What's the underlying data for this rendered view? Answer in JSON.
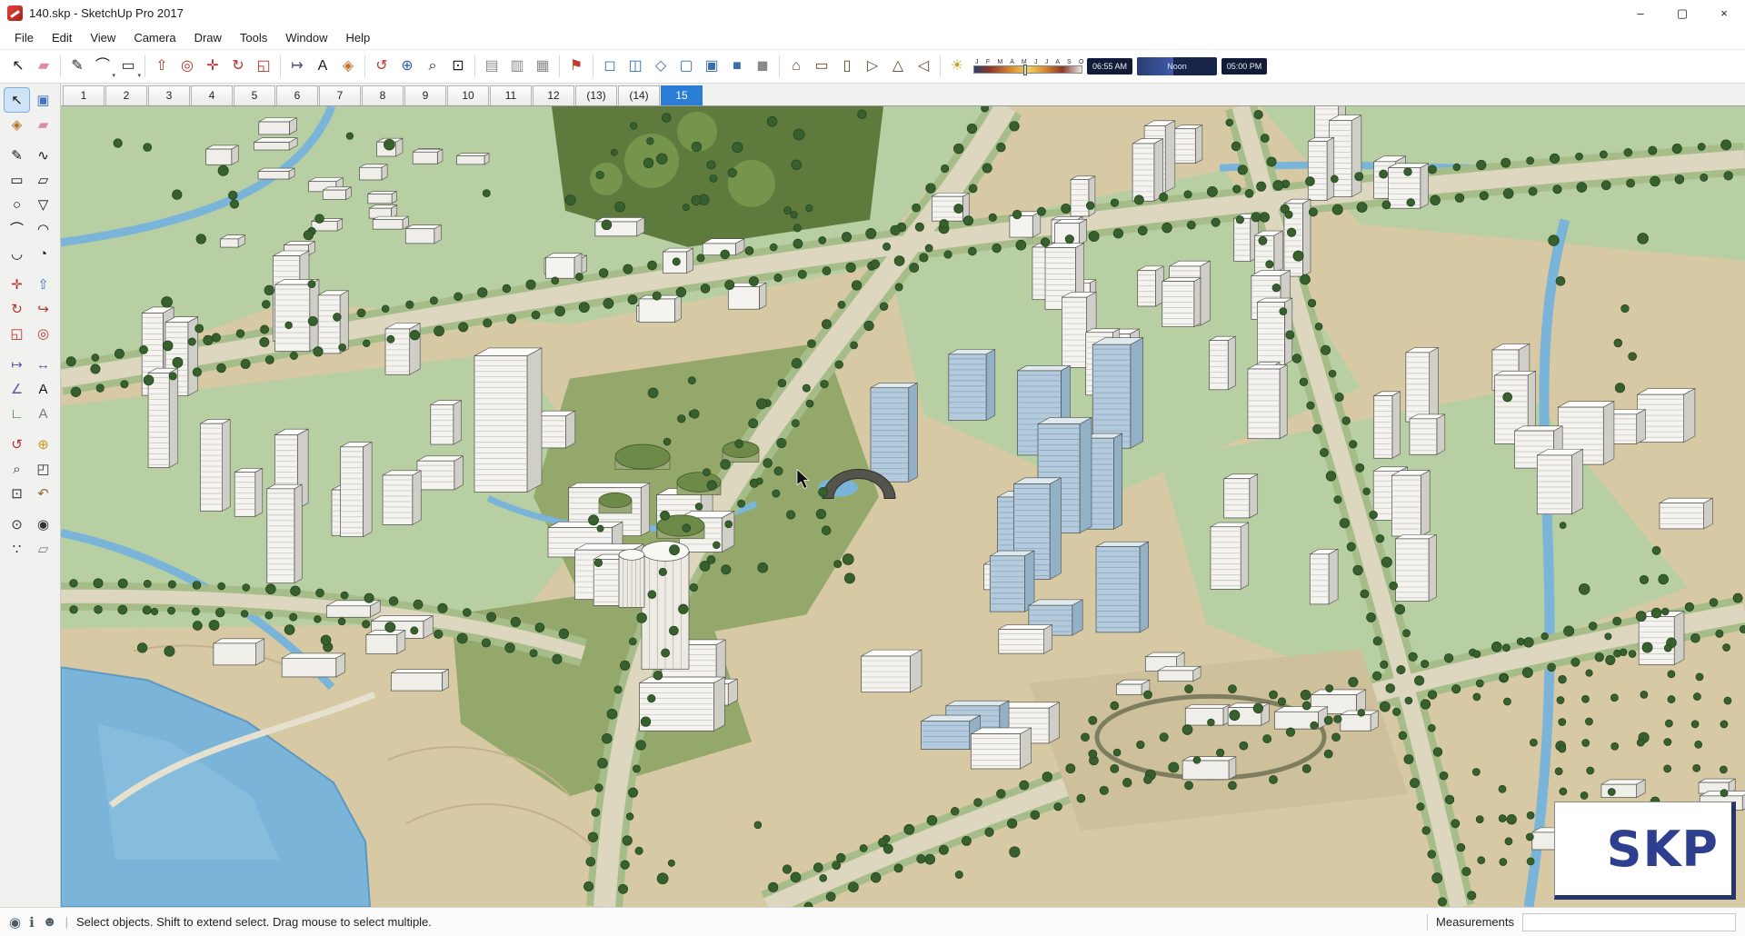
{
  "window": {
    "title": "140.skp - SketchUp Pro 2017",
    "controls": [
      {
        "name": "minimize",
        "glyph": "–"
      },
      {
        "name": "maximize",
        "glyph": "▢"
      },
      {
        "name": "close",
        "glyph": "×"
      }
    ]
  },
  "menu": {
    "items": [
      "File",
      "Edit",
      "View",
      "Camera",
      "Draw",
      "Tools",
      "Window",
      "Help"
    ]
  },
  "toolbar": {
    "tools": [
      {
        "name": "select",
        "glyph": "↖",
        "color": "#1a1a1a"
      },
      {
        "name": "eraser",
        "glyph": "▰",
        "color": "#e08aa8"
      },
      {
        "sep": true
      },
      {
        "name": "line",
        "glyph": "✎",
        "color": "#1a1a1a"
      },
      {
        "name": "arcs",
        "glyph": "⌒",
        "color": "#1a1a1a",
        "dropdown": true
      },
      {
        "name": "shapes",
        "glyph": "▭",
        "color": "#1a1a1a",
        "dropdown": true
      },
      {
        "sep": true
      },
      {
        "name": "push-pull",
        "glyph": "⇧",
        "color": "#b5342a"
      },
      {
        "name": "offset",
        "glyph": "◎",
        "color": "#b5342a"
      },
      {
        "name": "move",
        "glyph": "✛",
        "color": "#b5342a"
      },
      {
        "name": "rotate",
        "glyph": "↻",
        "color": "#b5342a"
      },
      {
        "name": "scale",
        "glyph": "◱",
        "color": "#b5342a"
      },
      {
        "sep": true
      },
      {
        "name": "tape-measure",
        "glyph": "↦",
        "color": "#4a4a8a"
      },
      {
        "name": "text",
        "glyph": "A",
        "color": "#1a1a1a"
      },
      {
        "name": "paint-bucket",
        "glyph": "◈",
        "color": "#c2702a"
      },
      {
        "sep": true
      },
      {
        "name": "orbit",
        "glyph": "↺",
        "color": "#c0392b"
      },
      {
        "name": "pan",
        "glyph": "⊕",
        "color": "#2e5fa3"
      },
      {
        "name": "zoom",
        "glyph": "⌕",
        "color": "#1a1a1a"
      },
      {
        "name": "zoom-extents",
        "glyph": "⊡",
        "color": "#1a1a1a"
      },
      {
        "sep": true
      },
      {
        "name": "section-plane",
        "glyph": "▤",
        "color": "#8a8a8a"
      },
      {
        "name": "section-fill",
        "glyph": "▥",
        "color": "#8a8a8a"
      },
      {
        "name": "section-display",
        "glyph": "▦",
        "color": "#8a8a8a"
      },
      {
        "sep": true
      },
      {
        "name": "add-location",
        "glyph": "⚑",
        "color": "#c0392b"
      },
      {
        "sep": true
      },
      {
        "name": "style-xray",
        "glyph": "◻",
        "color": "#3a6ea8"
      },
      {
        "name": "style-back-edges",
        "glyph": "◫",
        "color": "#3a6ea8"
      },
      {
        "name": "style-wireframe",
        "glyph": "◇",
        "color": "#3a6ea8"
      },
      {
        "name": "style-hidden-line",
        "glyph": "▢",
        "color": "#3a6ea8"
      },
      {
        "name": "style-shaded",
        "glyph": "▣",
        "color": "#3a6ea8"
      },
      {
        "name": "style-shaded-textures",
        "glyph": "■",
        "color": "#3a6ea8"
      },
      {
        "name": "style-monochrome",
        "glyph": "◼",
        "color": "#8a8a8a"
      },
      {
        "sep": true
      },
      {
        "name": "view-iso",
        "glyph": "⌂",
        "color": "#6a4a2a"
      },
      {
        "name": "view-top",
        "glyph": "▭",
        "color": "#6a4a2a"
      },
      {
        "name": "view-front",
        "glyph": "▯",
        "color": "#6a4a2a"
      },
      {
        "name": "view-right",
        "glyph": "▷",
        "color": "#6a4a2a"
      },
      {
        "name": "view-back",
        "glyph": "△",
        "color": "#6a4a2a"
      },
      {
        "name": "view-left",
        "glyph": "◁",
        "color": "#6a4a2a"
      },
      {
        "sep": true
      },
      {
        "name": "shadows-dialog",
        "glyph": "☀",
        "color": "#c8a22a"
      }
    ],
    "shadow": {
      "months": "J F M A M J J A S O N D",
      "time_start": "06:55 AM",
      "noon_label": "Noon",
      "time_end": "05:00 PM"
    }
  },
  "scene_tabs": {
    "tabs": [
      "1",
      "2",
      "3",
      "4",
      "5",
      "6",
      "7",
      "8",
      "9",
      "10",
      "11",
      "12",
      "(13)",
      "(14)",
      "15"
    ],
    "active": "15"
  },
  "tool_palette": {
    "groups": [
      [
        {
          "name": "select",
          "glyph": "↖",
          "color": "#111111",
          "active": true
        },
        {
          "name": "make-component",
          "glyph": "▣",
          "color": "#3f76c4"
        },
        {
          "name": "paint-bucket",
          "glyph": "◈",
          "color": "#b8742c"
        },
        {
          "name": "eraser",
          "glyph": "▰",
          "color": "#d98ca6"
        }
      ],
      [
        {
          "name": "line",
          "glyph": "✎",
          "color": "#111111"
        },
        {
          "name": "freehand",
          "glyph": "∿",
          "color": "#111111"
        },
        {
          "name": "rectangle",
          "glyph": "▭",
          "color": "#111111"
        },
        {
          "name": "rotated-rectangle",
          "glyph": "▱",
          "color": "#111111"
        },
        {
          "name": "circle",
          "glyph": "○",
          "color": "#111111"
        },
        {
          "name": "polygon",
          "glyph": "▽",
          "color": "#111111"
        },
        {
          "name": "arc",
          "glyph": "⌒",
          "color": "#111111"
        },
        {
          "name": "two-point-arc",
          "glyph": "◠",
          "color": "#111111"
        },
        {
          "name": "three-point-arc",
          "glyph": "◡",
          "color": "#111111"
        },
        {
          "name": "pie",
          "glyph": "◔",
          "color": "#111111"
        }
      ],
      [
        {
          "name": "move",
          "glyph": "✛",
          "color": "#b3342c"
        },
        {
          "name": "push-pull",
          "glyph": "⇧",
          "color": "#3f76c4"
        },
        {
          "name": "rotate",
          "glyph": "↻",
          "color": "#b3342c"
        },
        {
          "name": "follow-me",
          "glyph": "↪",
          "color": "#b3342c"
        },
        {
          "name": "scale",
          "glyph": "◱",
          "color": "#b3342c"
        },
        {
          "name": "offset",
          "glyph": "◎",
          "color": "#b3342c"
        }
      ],
      [
        {
          "name": "tape-measure",
          "glyph": "↦",
          "color": "#5a5aa0"
        },
        {
          "name": "dimensions",
          "glyph": "↔",
          "color": "#5a5aa0"
        },
        {
          "name": "protractor",
          "glyph": "∠",
          "color": "#5a5aa0"
        },
        {
          "name": "text",
          "glyph": "A",
          "color": "#111111"
        },
        {
          "name": "axes",
          "glyph": "∟",
          "color": "#2a7a2a"
        },
        {
          "name": "three-d-text",
          "glyph": "A",
          "color": "#777777"
        }
      ],
      [
        {
          "name": "orbit",
          "glyph": "↺",
          "color": "#b3342c"
        },
        {
          "name": "pan",
          "glyph": "⊕",
          "color": "#c7991f"
        },
        {
          "name": "zoom",
          "glyph": "⌕",
          "color": "#333333"
        },
        {
          "name": "zoom-window",
          "glyph": "◰",
          "color": "#333333"
        },
        {
          "name": "zoom-extents",
          "glyph": "⊡",
          "color": "#333333"
        },
        {
          "name": "previous",
          "glyph": "↶",
          "color": "#8a6a3a"
        }
      ],
      [
        {
          "name": "position-camera",
          "glyph": "⊙",
          "color": "#333333"
        },
        {
          "name": "look-around",
          "glyph": "◉",
          "color": "#333333"
        },
        {
          "name": "walk",
          "glyph": "∵",
          "color": "#333333"
        },
        {
          "name": "section-plane",
          "glyph": "▱",
          "color": "#7a7a7a"
        }
      ]
    ]
  },
  "statusbar": {
    "icons": [
      {
        "name": "geolocation",
        "glyph": "◉"
      },
      {
        "name": "info",
        "glyph": "ℹ"
      },
      {
        "name": "account",
        "glyph": "☻"
      }
    ],
    "message": "Select objects. Shift to extend select. Drag mouse to select multiple.",
    "measurements_label": "Measurements",
    "measurements_value": ""
  },
  "viewport": {
    "watermark": "SKP"
  }
}
